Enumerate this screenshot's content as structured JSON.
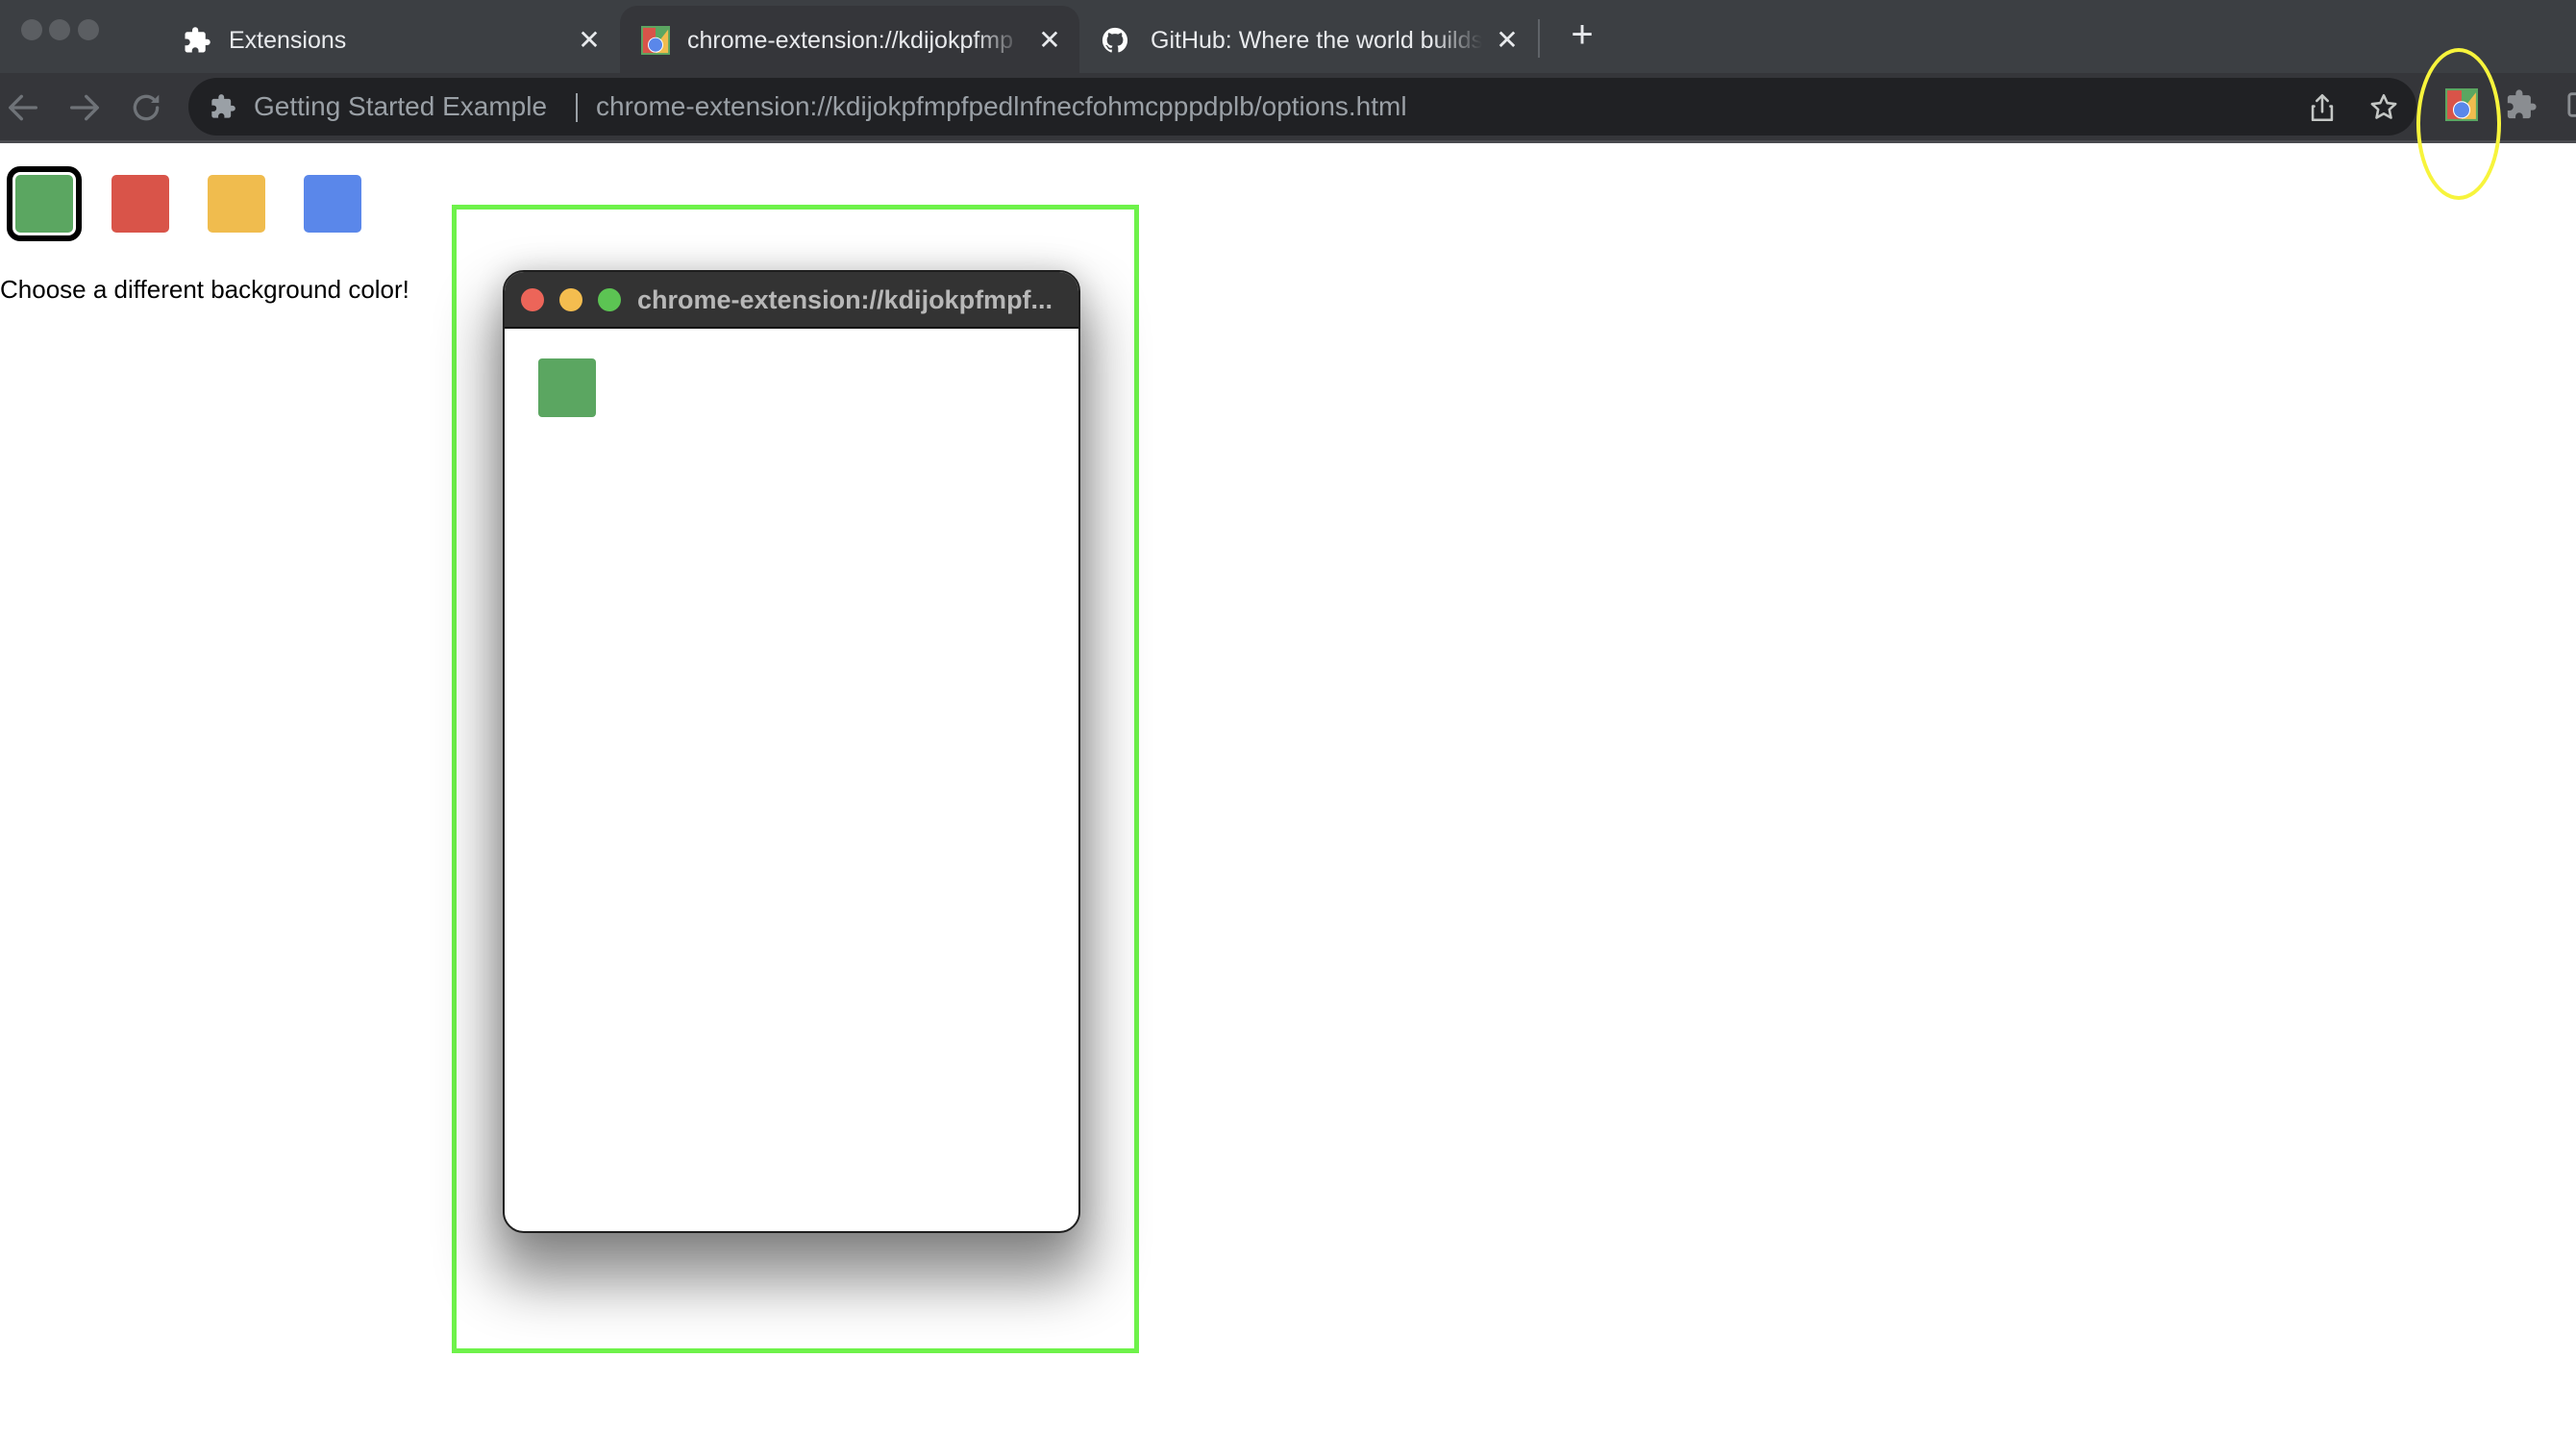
{
  "window": {
    "traffic_lights": [
      "close",
      "minimize",
      "zoom"
    ]
  },
  "tabs": [
    {
      "label": "Extensions",
      "icon": "puzzle-icon",
      "active": false,
      "close": "✕"
    },
    {
      "label": "chrome-extension://kdijokpfmp",
      "icon": "extension-favicon",
      "active": true,
      "close": "✕"
    },
    {
      "label": "GitHub: Where the world builds",
      "icon": "github-icon",
      "active": false,
      "close": "✕"
    }
  ],
  "new_tab_label": "+",
  "toolbar": {
    "back_icon": "arrow-left-icon",
    "forward_icon": "arrow-right-icon",
    "reload_icon": "reload-icon",
    "omnibox": {
      "site_icon": "puzzle-icon",
      "site_name": "Getting Started Example",
      "url": "chrome-extension://kdijokpfmpfpedlnfnecfohmcpppdplb/options.html"
    },
    "share_icon": "share-icon",
    "bookmark_icon": "star-icon",
    "extension_action_icon": "extension-favicon",
    "extensions_menu_icon": "puzzle-icon",
    "side_panel_icon": "side-panel-icon"
  },
  "page": {
    "swatches": [
      {
        "name": "green",
        "color": "#5ba661",
        "selected": true
      },
      {
        "name": "red",
        "color": "#d95449",
        "selected": false
      },
      {
        "name": "yellow",
        "color": "#f0bc4e",
        "selected": false
      },
      {
        "name": "blue",
        "color": "#5a87ea",
        "selected": false
      }
    ],
    "instruction": "Choose a different background color!"
  },
  "popup": {
    "title": "chrome-extension://kdijokpfmpf...",
    "dot_colors": [
      "#ec6559",
      "#f4bd4f",
      "#5cc453"
    ],
    "button_color": "#5ba661"
  },
  "annotations": {
    "highlight_color": "#6ef24a",
    "ellipse_color": "#f7f43c"
  }
}
